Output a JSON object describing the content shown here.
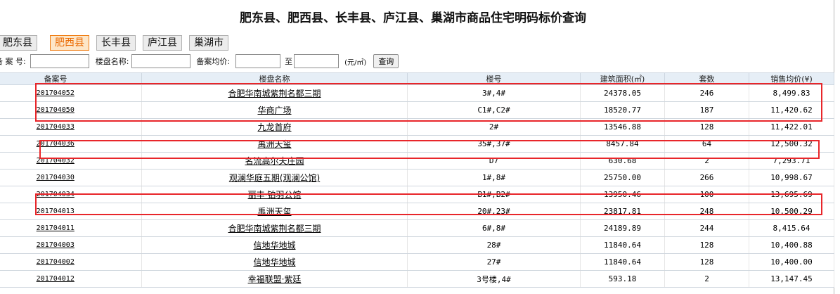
{
  "page": {
    "title": "肥东县、肥西县、长丰县、庐江县、巢湖市商品住宅明码标价查询"
  },
  "tabs": [
    {
      "label": "肥东县",
      "active": false
    },
    {
      "label": "肥西县",
      "active": true
    },
    {
      "label": "长丰县",
      "active": false
    },
    {
      "label": "庐江县",
      "active": false
    },
    {
      "label": "巢湖市",
      "active": false
    }
  ],
  "search": {
    "record_no_label": "备 案 号:",
    "record_no_value": "",
    "building_name_label": "楼盘名称:",
    "building_name_value": "",
    "avg_price_label": "备案均价:",
    "price_from_value": "",
    "to_label": "至",
    "price_to_value": "",
    "unit_label": "(元/㎡)",
    "query_button": "查询"
  },
  "table": {
    "headers": [
      "备案号",
      "楼盘名称",
      "楼号",
      "建筑面积(㎡)",
      "套数",
      "销售均价(¥)"
    ],
    "rows": [
      {
        "record_no": "201704052",
        "name": "合肥华南城紫荆名都三期",
        "building": "3#,4#",
        "area": "24378.05",
        "units": "246",
        "price": "8,499.83"
      },
      {
        "record_no": "201704050",
        "name": "华商广场",
        "building": "C1#,C2#",
        "area": "18520.77",
        "units": "187",
        "price": "11,420.62"
      },
      {
        "record_no": "201704033",
        "name": "九龙首府",
        "building": "2#",
        "area": "13546.88",
        "units": "128",
        "price": "11,422.01"
      },
      {
        "record_no": "201704036",
        "name": "禹洲天玺",
        "building": "35#,37#",
        "area": "8457.84",
        "units": "64",
        "price": "12,500.32"
      },
      {
        "record_no": "201704032",
        "name": "名流高尔夫庄园",
        "building": "D7",
        "area": "630.68",
        "units": "2",
        "price": "7,293.71"
      },
      {
        "record_no": "201704030",
        "name": "观澜华庭五期(观澜公馆)",
        "building": "1#,8#",
        "area": "25750.00",
        "units": "266",
        "price": "10,998.67"
      },
      {
        "record_no": "201704034",
        "name": "丽丰·铂羽公馆",
        "building": "B1#,B2#",
        "area": "13950.46",
        "units": "100",
        "price": "13,695.69"
      },
      {
        "record_no": "201704013",
        "name": "禹洲天玺",
        "building": "20#,23#",
        "area": "23817.81",
        "units": "248",
        "price": "10,500.29"
      },
      {
        "record_no": "201704011",
        "name": "合肥华南城紫荆名都三期",
        "building": "6#,8#",
        "area": "24189.89",
        "units": "244",
        "price": "8,415.64"
      },
      {
        "record_no": "201704003",
        "name": "信地华地城",
        "building": "28#",
        "area": "11840.64",
        "units": "128",
        "price": "10,400.88"
      },
      {
        "record_no": "201704002",
        "name": "信地华地城",
        "building": "27#",
        "area": "11840.64",
        "units": "128",
        "price": "10,400.00"
      },
      {
        "record_no": "201704012",
        "name": "幸福联盟·紫廷",
        "building": "3号楼,4#",
        "area": "593.18",
        "units": "2",
        "price": "13,147.45"
      }
    ]
  },
  "colors": {
    "highlight": "#e8262a",
    "active_tab": "#ea6b04",
    "header_bg": "#e6eef6"
  }
}
